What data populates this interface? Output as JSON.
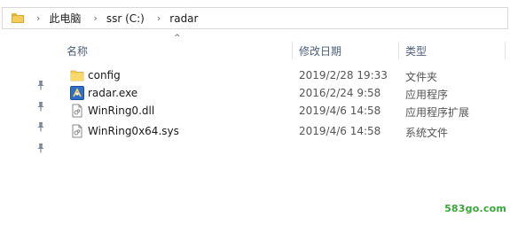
{
  "address_bar": {
    "breadcrumbs": [
      "此电脑",
      "ssr (C:)",
      "radar"
    ]
  },
  "columns": {
    "name": "名称",
    "modified": "修改日期",
    "type": "类型"
  },
  "files": [
    {
      "name": "config",
      "modified": "2019/2/28 19:33",
      "type": "文件夹",
      "icon": "folder-icon"
    },
    {
      "name": "radar.exe",
      "modified": "2016/2/24 9:58",
      "type": "应用程序",
      "icon": "exe-icon"
    },
    {
      "name": "WinRing0.dll",
      "modified": "2019/4/6 14:58",
      "type": "应用程序扩展",
      "icon": "dll-file-icon"
    },
    {
      "name": "WinRing0x64.sys",
      "modified": "2019/4/6 14:58",
      "type": "系统文件",
      "icon": "sys-file-icon"
    }
  ],
  "watermark": "583go.com",
  "colors": {
    "folder": "#f4cc58",
    "header_text": "#4c607a",
    "watermark": "#3aa63a"
  }
}
